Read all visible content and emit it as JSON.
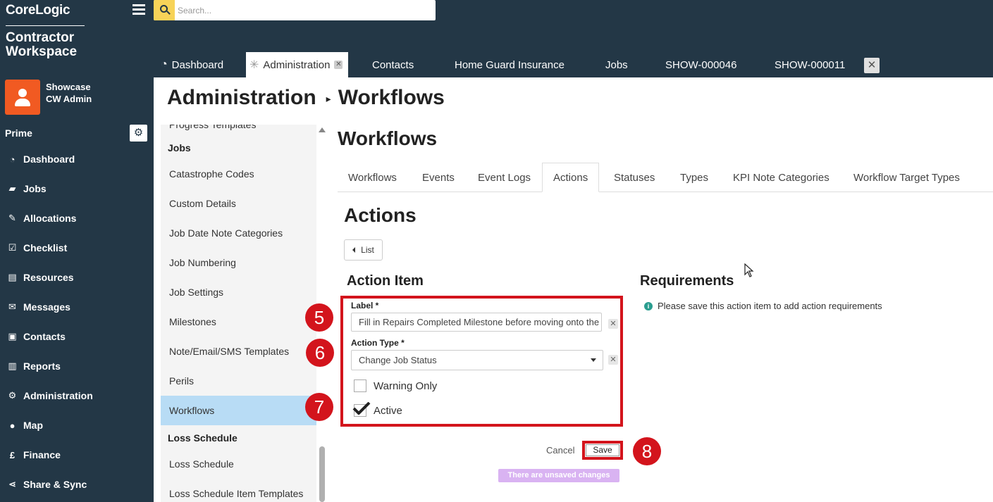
{
  "brand": "CoreLogic",
  "app_name": [
    "Contractor",
    "Workspace"
  ],
  "user": {
    "org": "Showcase",
    "role": "CW Admin"
  },
  "sidebar": {
    "section_title": "Prime",
    "items": [
      {
        "label": "Dashboard",
        "icon": "dashboard-icon"
      },
      {
        "label": "Jobs",
        "icon": "folder-icon"
      },
      {
        "label": "Allocations",
        "icon": "wrench-icon"
      },
      {
        "label": "Checklist",
        "icon": "checkbox-icon"
      },
      {
        "label": "Resources",
        "icon": "clipboard-icon"
      },
      {
        "label": "Messages",
        "icon": "envelope-icon"
      },
      {
        "label": "Contacts",
        "icon": "address-book-icon"
      },
      {
        "label": "Reports",
        "icon": "bar-chart-icon"
      },
      {
        "label": "Administration",
        "icon": "gear-icon"
      },
      {
        "label": "Map",
        "icon": "globe-icon"
      },
      {
        "label": "Finance",
        "icon": "pound-icon"
      },
      {
        "label": "Share & Sync",
        "icon": "share-icon"
      }
    ]
  },
  "search": {
    "placeholder": "Search..."
  },
  "tabs": [
    {
      "label": "Dashboard"
    },
    {
      "label": "Administration"
    },
    {
      "label": "Contacts"
    },
    {
      "label": "Home Guard Insurance"
    },
    {
      "label": "Jobs"
    },
    {
      "label": "SHOW-000046"
    },
    {
      "label": "SHOW-000011"
    }
  ],
  "breadcrumb": {
    "parent": "Administration",
    "current": "Workflows"
  },
  "subnav": {
    "cut_item": "Progress Templates",
    "groups": [
      {
        "title": "Jobs"
      },
      {
        "title": "Loss Schedule"
      }
    ],
    "items": [
      "Catastrophe Codes",
      "Custom Details",
      "Job Date Note Categories",
      "Job Numbering",
      "Job Settings",
      "Milestones",
      "Note/Email/SMS Templates",
      "Perils",
      "Workflows",
      "Loss Schedule",
      "Loss Schedule Item Templates"
    ]
  },
  "content": {
    "title": "Workflows",
    "tabs": [
      "Workflows",
      "Events",
      "Event Logs",
      "Actions",
      "Statuses",
      "Types",
      "KPI Note Categories",
      "Workflow Target Types"
    ],
    "active_tab": "Actions",
    "section_title": "Actions",
    "list_button": "List",
    "action_item": {
      "heading": "Action Item",
      "label_field": {
        "label": "Label *",
        "value": "Fill in Repairs Completed Milestone before moving onto the next status"
      },
      "action_type_field": {
        "label": "Action Type *",
        "value": "Change Job Status"
      },
      "warning_only": {
        "label": "Warning Only",
        "checked": false
      },
      "active": {
        "label": "Active",
        "checked": true
      }
    },
    "requirements": {
      "heading": "Requirements",
      "note": "Please save this action item to add action requirements"
    },
    "cancel_label": "Cancel",
    "save_label": "Save",
    "unsaved_notice": "There are unsaved changes"
  },
  "annotations": [
    "5",
    "6",
    "7",
    "8"
  ],
  "colors": {
    "sidebar_bg": "#233746",
    "accent_orange": "#f15a22",
    "highlight_red": "#d3141c",
    "selected_row": "#b8dcf5",
    "unsaved_badge": "#d9b3f2"
  }
}
